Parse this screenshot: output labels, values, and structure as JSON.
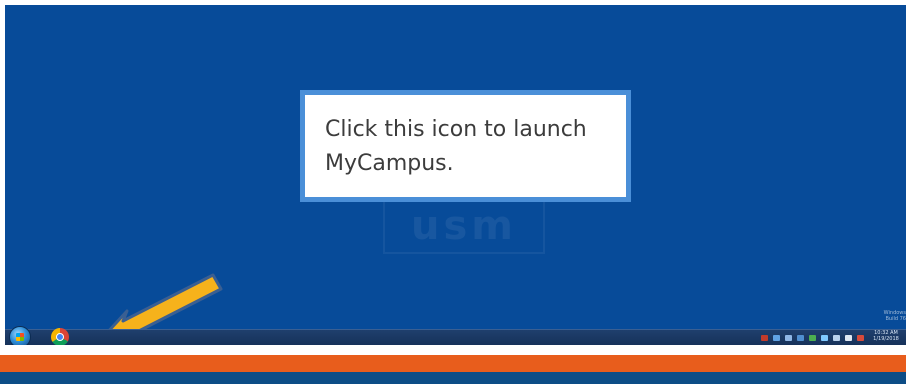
{
  "callout": {
    "line1": "Click this icon to launch",
    "line2": "MyCampus."
  },
  "desktop": {
    "watermark_text": "usm"
  },
  "taskbar": {
    "start_icon": "windows-start-orb",
    "pinned_app_icon": "chrome-icon",
    "clock_time": "10:32 AM",
    "clock_date": "1/19/2018"
  },
  "notice": {
    "line1": "Windows",
    "line2": "Build 76"
  },
  "colors": {
    "desktop": "#074b99",
    "callout_border": "#4a8fd8",
    "arrow": "#f6b21b",
    "band_orange": "#e85d1c",
    "band_blue": "#0d4d86"
  }
}
